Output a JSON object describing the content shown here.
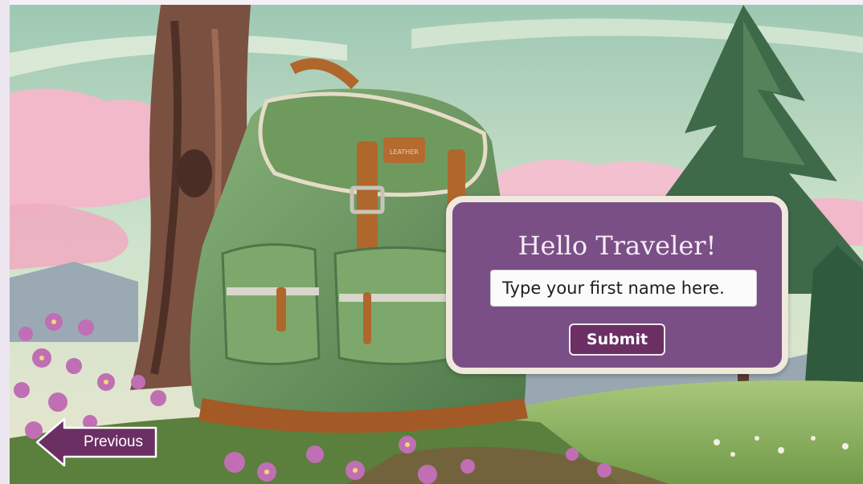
{
  "card": {
    "title": "Hello Traveler!",
    "name_placeholder": "Type your first name here.",
    "name_value": "",
    "submit_label": "Submit"
  },
  "nav": {
    "previous_label": "Previous"
  },
  "colors": {
    "card_bg": "#7a4f86",
    "card_border": "#efe8dc",
    "button_bg": "#6b2f64",
    "sky": "#cfe3d4",
    "clouds": "#f1b9c9",
    "backpack": "#6f9a5e",
    "leather": "#b0672c",
    "flowers": "#c06fb4"
  },
  "scene": {
    "backpack_label": "LEATHER"
  }
}
